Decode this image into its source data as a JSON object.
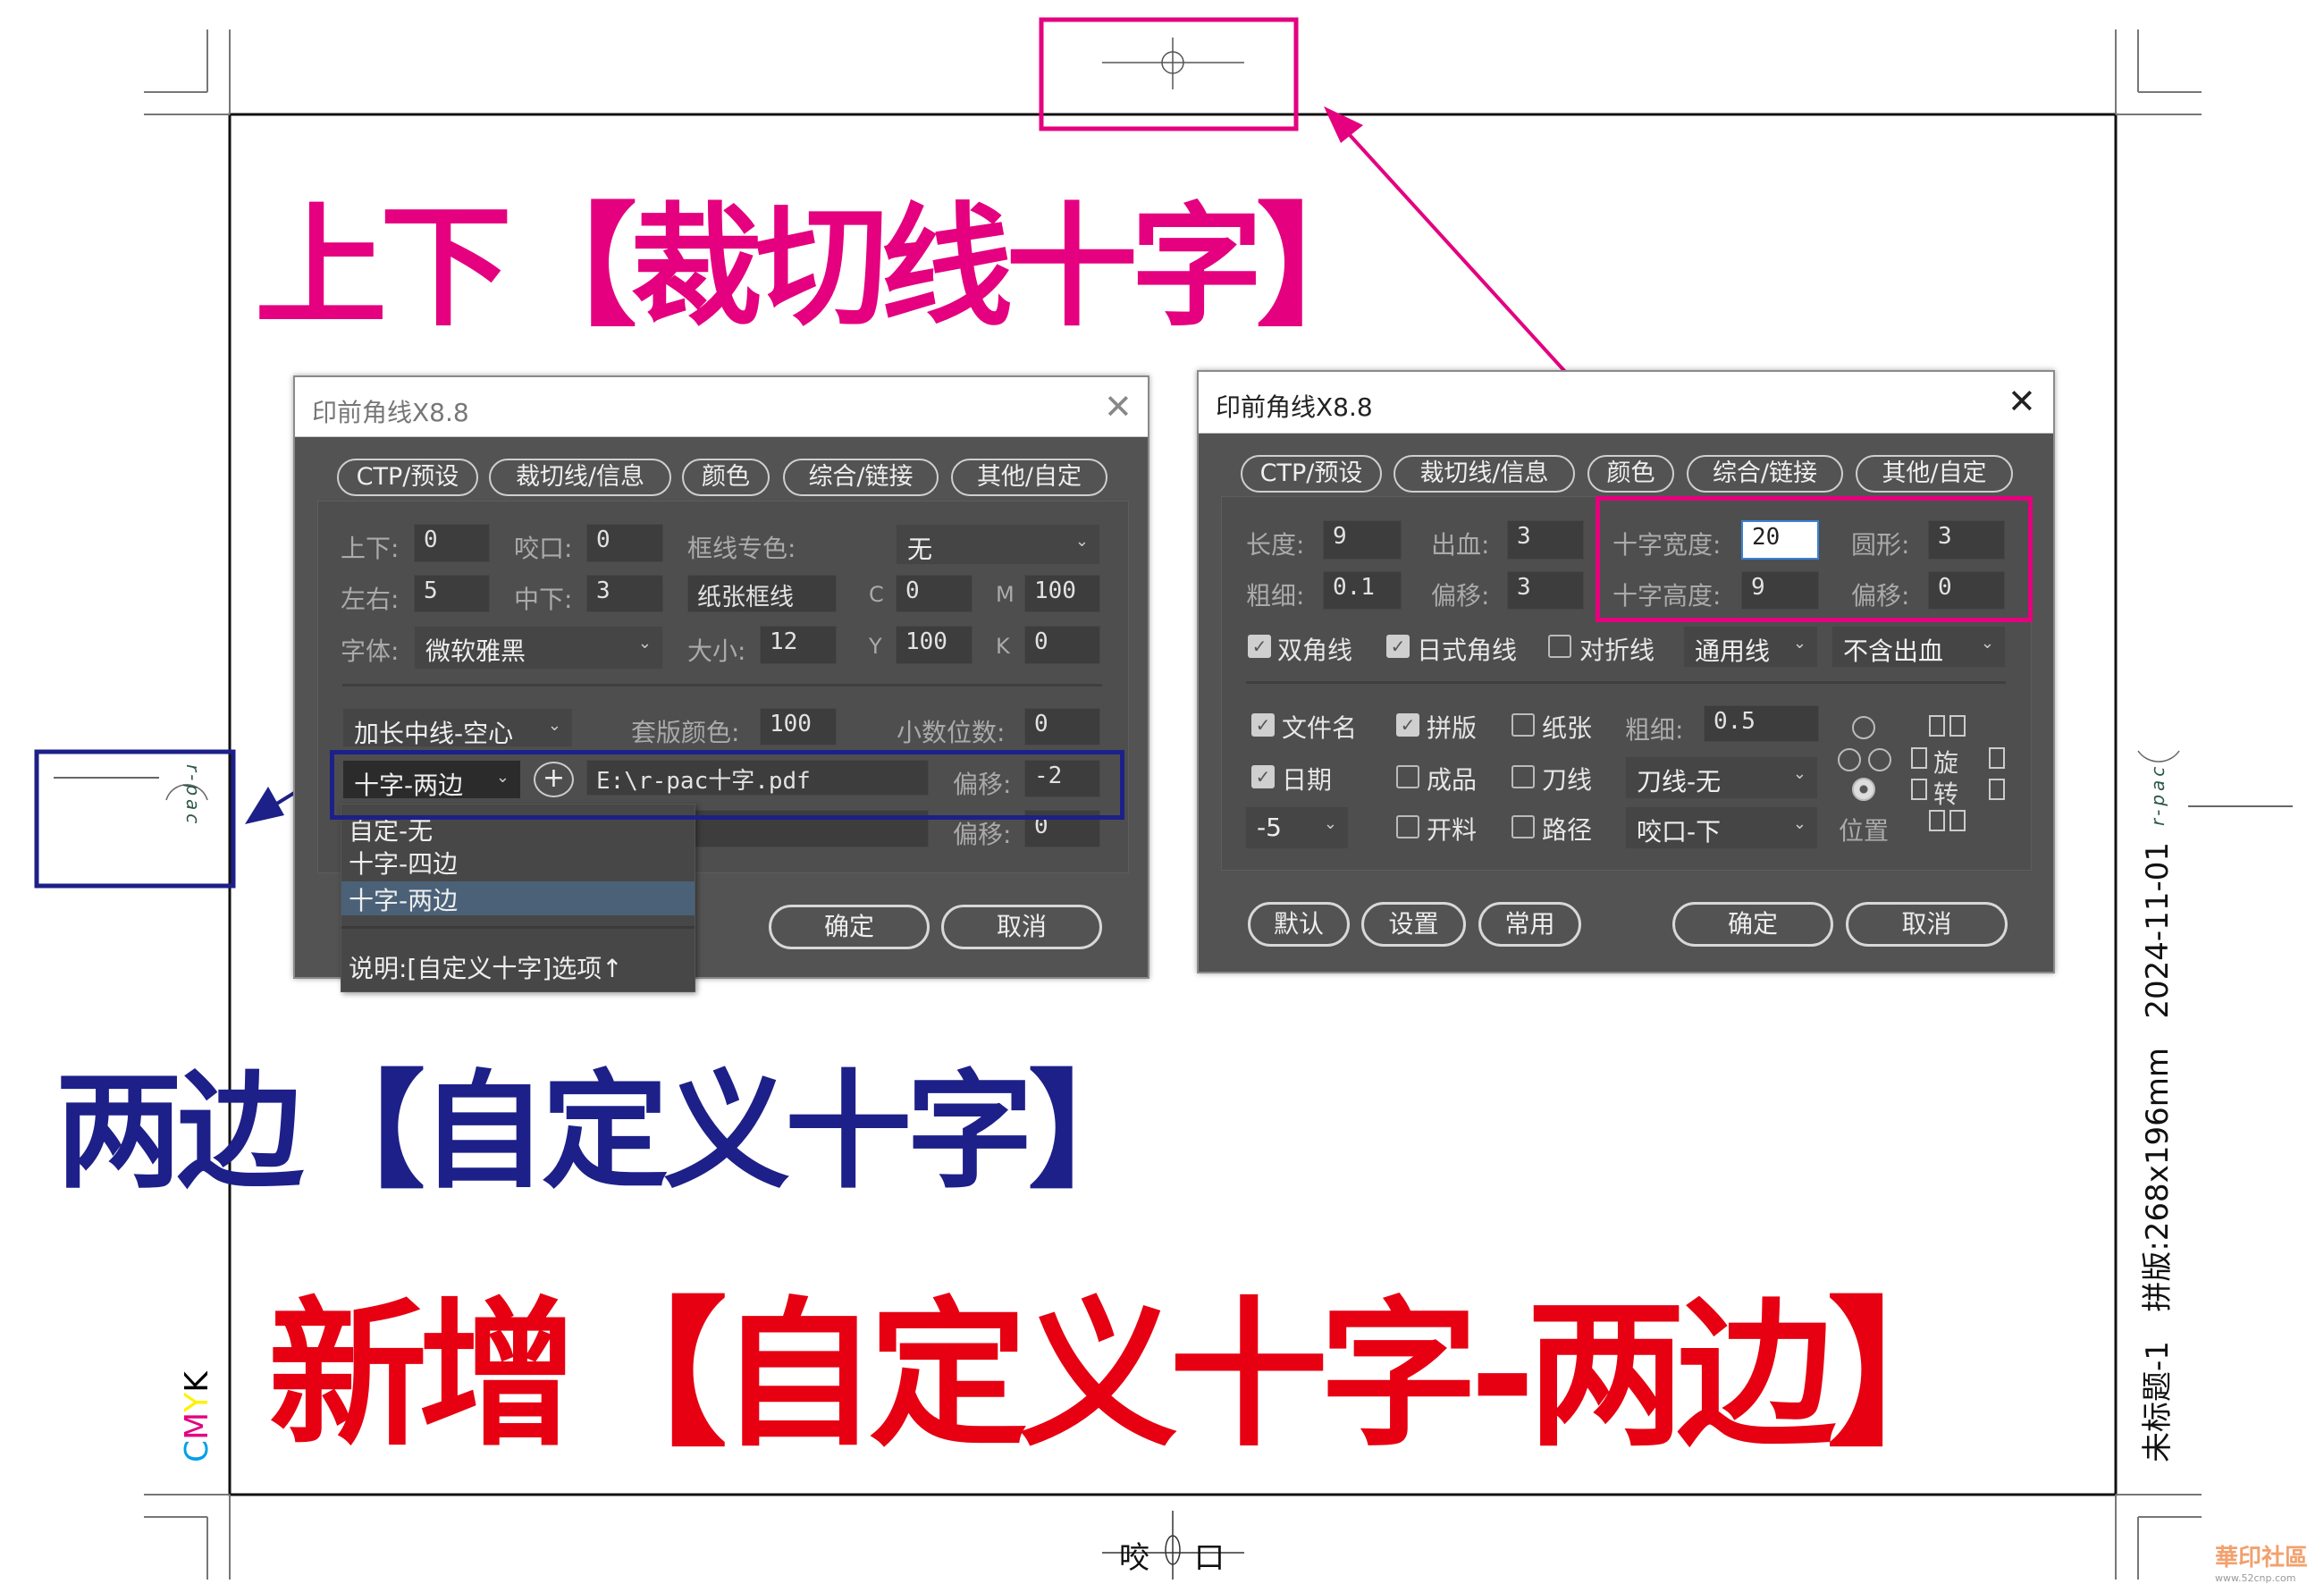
{
  "headlines": {
    "top": "上下【裁切线十字】",
    "middle": "两边【自定义十字】",
    "bottom": "新增【自定义十字-两边】"
  },
  "colors": {
    "magenta": "#e4007f",
    "navy": "#1d2088",
    "red": "#e60012",
    "dialog_bg": "#535353"
  },
  "marks": {
    "bite_left": "咬",
    "bite_right": "口",
    "cmyk": [
      "C",
      "M",
      "Y",
      "K"
    ],
    "cmyk_colors": [
      "#00a0e9",
      "#e4007f",
      "#fff100",
      "#000000"
    ],
    "rpac": "r-pac",
    "slug": {
      "title": "未标题-1",
      "imposition": "拼版:268x196mm",
      "date": "2024-11-01"
    },
    "watermark": {
      "name": "華印社區",
      "url": "www.52cnp.com"
    }
  },
  "left_dialog": {
    "title": "印前角线X8.8",
    "tabs": [
      "CTP/预设",
      "裁切线/信息",
      "颜色",
      "综合/链接",
      "其他/自定"
    ],
    "fields": {
      "updown": {
        "label": "上下:",
        "value": "0"
      },
      "bite": {
        "label": "咬口:",
        "value": "0"
      },
      "frame_spot": {
        "label": "框线专色:",
        "value": "无"
      },
      "leftright": {
        "label": "左右:",
        "value": "5"
      },
      "middown": {
        "label": "中下:",
        "value": "3"
      },
      "paper_frame": "纸张框线",
      "c": {
        "label": "C",
        "value": "0"
      },
      "m": {
        "label": "M",
        "value": "100"
      },
      "font": {
        "label": "字体:",
        "value": "微软雅黑"
      },
      "size": {
        "label": "大小:",
        "value": "12"
      },
      "y": {
        "label": "Y",
        "value": "100"
      },
      "k": {
        "label": "K",
        "value": "0"
      },
      "centerline": "加长中线-空心",
      "reg_color": {
        "label": "套版颜色:",
        "value": "100"
      },
      "decimals": {
        "label": "小数位数:",
        "value": "0"
      },
      "cross_type": "十字-两边",
      "file_path": "E:\\r-pac十字.pdf",
      "offset1": {
        "label": "偏移:",
        "value": "-2"
      },
      "offset2": {
        "label": "偏移:",
        "value": "0"
      }
    },
    "dropdown_items": [
      "自定-无",
      "十字-四边",
      "十字-两边"
    ],
    "dropdown_selected": "十字-两边",
    "dropdown_note": "说明:[自定义十字]选项↑",
    "ok": "确定",
    "cancel": "取消"
  },
  "right_dialog": {
    "title": "印前角线X8.8",
    "tabs": [
      "CTP/预设",
      "裁切线/信息",
      "颜色",
      "综合/链接",
      "其他/自定"
    ],
    "fields": {
      "length": {
        "label": "长度:",
        "value": "9"
      },
      "bleed": {
        "label": "出血:",
        "value": "3"
      },
      "cross_width": {
        "label": "十字宽度:",
        "value": "20"
      },
      "circle": {
        "label": "圆形:",
        "value": "3"
      },
      "thickness": {
        "label": "粗细:",
        "value": "0.1"
      },
      "offset": {
        "label": "偏移:",
        "value": "3"
      },
      "cross_height": {
        "label": "十字高度:",
        "value": "9"
      },
      "offset2": {
        "label": "偏移:",
        "value": "0"
      },
      "thickness2": {
        "label": "粗细:",
        "value": "0.5"
      }
    },
    "checkboxes": [
      {
        "label": "双角线",
        "checked": true
      },
      {
        "label": "日式角线",
        "checked": true
      },
      {
        "label": "对折线",
        "checked": false
      },
      {
        "label": "文件名",
        "checked": true
      },
      {
        "label": "拼版",
        "checked": true
      },
      {
        "label": "纸张",
        "checked": false
      },
      {
        "label": "日期",
        "checked": true
      },
      {
        "label": "成品",
        "checked": false
      },
      {
        "label": "刀线",
        "checked": false
      },
      {
        "label": "开料",
        "checked": false
      },
      {
        "label": "路径",
        "checked": false
      }
    ],
    "selects": {
      "line_type": "通用线",
      "bleed_mode": "不含出血",
      "die_line": "刀线-无",
      "bite_side": "咬口-下",
      "offset_val": "-5"
    },
    "position_label": "位置",
    "rotate_labels": [
      "旋",
      "转"
    ],
    "buttons": {
      "default": "默认",
      "settings": "设置",
      "common": "常用",
      "ok": "确定",
      "cancel": "取消"
    }
  }
}
